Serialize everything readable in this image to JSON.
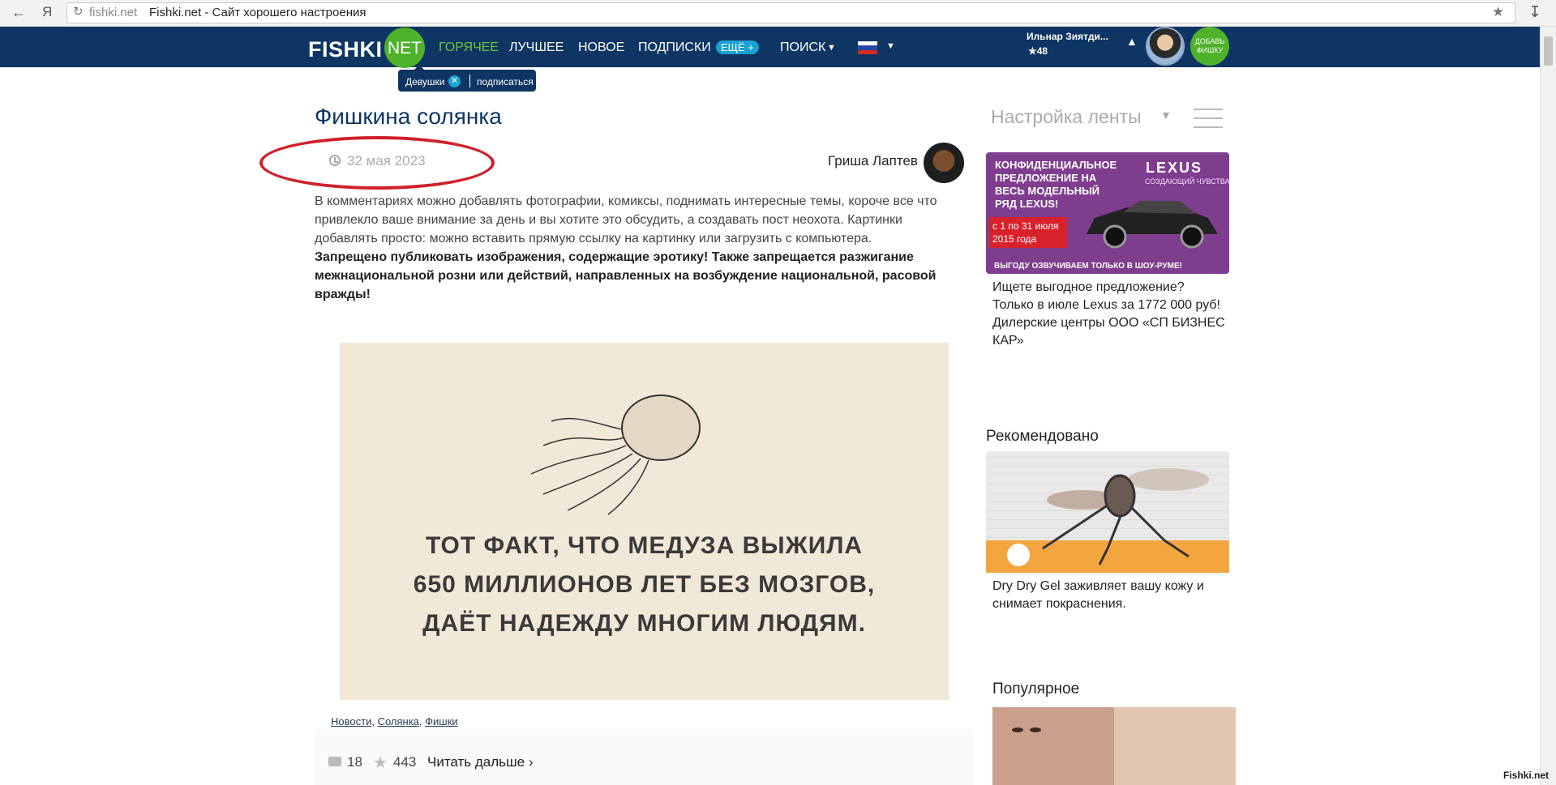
{
  "browser": {
    "back_icon": "arrow-left-icon",
    "logo": "Я",
    "address_domain": "fishki.net",
    "address_title": "Fishki.net - Сайт хорошего настроения"
  },
  "nav": {
    "logo_text": "FISHKI",
    "logo_net": "NET",
    "items": [
      "ГОРЯЧЕЕ",
      "ЛУЧШЕЕ",
      "НОВОЕ",
      "ПОДПИСКИ",
      "ПОИСК"
    ],
    "more_badge": "ЕЩЁ +",
    "user_name": "Ильнар Зиятди...",
    "user_points": "★48",
    "add_button": "ДОБАВЬ ФИШКУ",
    "active_color": "#6cc43c",
    "bar_color": "#0e3563"
  },
  "tooltip": {
    "tag": "Девушки",
    "subscribe": "подписаться"
  },
  "post": {
    "title": "Фишкина солянка",
    "date": "32 мая 2023",
    "author": "Гриша Лаптев",
    "body": "В комментариях можно добавлять фотографии, комиксы, поднимать интересные темы, короче все что привлекло ваше внимание за день и вы хотите это обсудить, а создавать пост неохота. Картинки добавлять просто: можно вставить прямую ссылку на картинку или загрузить с компьютера.",
    "body_bold": "Запрещено публиковать изображения, содержащие эротику! Также запрещается разжигание межнациональной розни или действий, направленных на возбуждение национальной, расовой вражды!",
    "image_caption": "ТОТ ФАКТ, ЧТО МЕДУЗА ВЫЖИЛА\n650 МИЛЛИОНОВ ЛЕТ БЕЗ МОЗГОВ,\nДАЁТ НАДЕЖДУ МНОГИМ ЛЮДЯМ.",
    "tags": [
      "Новости",
      "Солянка",
      "Фишки"
    ],
    "comments": "18",
    "stars": "443",
    "read_more": "Читать дальше ›"
  },
  "sidebar": {
    "feed_settings": "Настройка ленты",
    "ad": {
      "headline": "КОНФИДЕНЦИАЛЬНОЕ\nПРЕДЛОЖЕНИЕ НА\nВЕСЬ МОДЕЛЬНЫЙ\nРЯД LEXUS!",
      "brand": "LEXUS",
      "slogan": "СОЗДАЮЩИЙ ЧУВСТВА",
      "date": "с 1 по 31 июля\n2015 года",
      "bottom": "ВЫГОДУ ОЗВУЧИВАЕМ ТОЛЬКО В ШОУ-РУМЕ!",
      "text": "Ищете выгодное предложение? Только в июле Lexus за 1772 000 руб! Дилерские центры ООО «СП БИЗНЕС КАР»"
    },
    "recommended_title": "Рекомендовано",
    "recommended_text": "Dry Dry Gel заживляет вашу кожу и снимает покраснения.",
    "popular_title": "Популярное"
  },
  "watermark": "Fishki.net"
}
